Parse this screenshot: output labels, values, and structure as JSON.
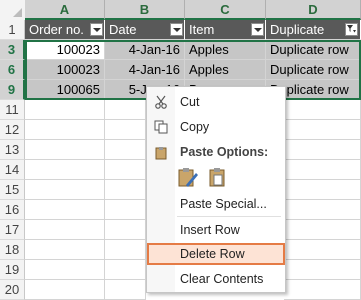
{
  "columns": [
    "A",
    "B",
    "C",
    "D"
  ],
  "rows": [
    "1",
    "3",
    "6",
    "9",
    "11",
    "12",
    "13",
    "14",
    "15",
    "16",
    "17",
    "18",
    "19",
    "20"
  ],
  "table_headers": [
    "Order no.",
    "Date",
    "Item",
    "Duplicate"
  ],
  "data_rows": [
    {
      "order": "100023",
      "date": "4-Jan-16",
      "item": "Apples",
      "dup": "Duplicate row"
    },
    {
      "order": "100023",
      "date": "4-Jan-16",
      "item": "Apples",
      "dup": "Duplicate row"
    },
    {
      "order": "100065",
      "date": "5-Jan-16",
      "item": "Bananas",
      "dup": "Duplicate row"
    }
  ],
  "context_menu": {
    "cut": "Cut",
    "copy": "Copy",
    "paste_options": "Paste Options:",
    "paste_special": "Paste Special...",
    "insert_row": "Insert Row",
    "delete_row": "Delete Row",
    "clear_contents": "Clear Contents"
  },
  "colors": {
    "header_bg": "#595959",
    "selection_bg": "#c6c6c6",
    "accent": "#217346",
    "menu_highlight": "#e57b45"
  }
}
